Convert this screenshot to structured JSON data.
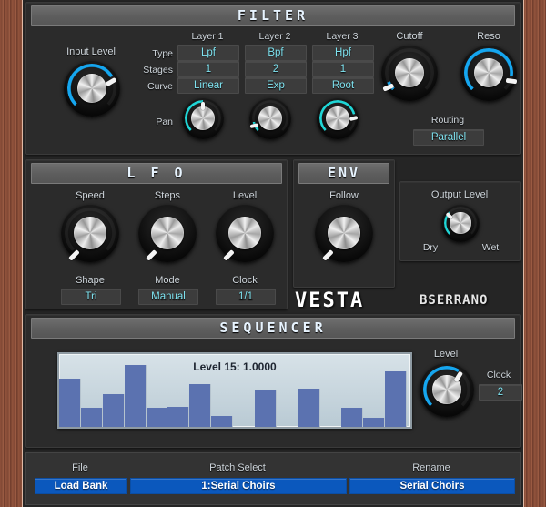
{
  "app": {
    "brand": "VESTA",
    "vendor": "BSERRANO"
  },
  "filter": {
    "title": "FILTER",
    "input_level_label": "Input Level",
    "input_level_value": 0.72,
    "row_labels": [
      "Type",
      "Stages",
      "Curve"
    ],
    "layer_headers": [
      "Layer 1",
      "Layer 2",
      "Layer 3"
    ],
    "type": [
      "Lpf",
      "Bpf",
      "Hpf"
    ],
    "stages": [
      "1",
      "2",
      "1"
    ],
    "curve": [
      "Linear",
      "Exp",
      "Root"
    ],
    "pan_label": "Pan",
    "pan_values": [
      0.5,
      0.12,
      0.78
    ],
    "cutoff_label": "Cutoff",
    "cutoff_value": 0.08,
    "reso_label": "Reso",
    "reso_value": 0.86,
    "routing_label": "Routing",
    "routing_value": "Parallel"
  },
  "lfo": {
    "title": "L F O",
    "knobs": [
      {
        "label": "Speed",
        "value": 0.0
      },
      {
        "label": "Steps",
        "value": 0.0
      },
      {
        "label": "Level",
        "value": 0.0
      }
    ],
    "shape_label": "Shape",
    "shape_value": "Tri",
    "mode_label": "Mode",
    "mode_value": "Manual",
    "clock_label": "Clock",
    "clock_value": "1/1"
  },
  "env": {
    "title": "ENV",
    "follow_label": "Follow",
    "follow_value": 0.0
  },
  "output": {
    "label": "Output Level",
    "value": 0.33,
    "dry_label": "Dry",
    "wet_label": "Wet"
  },
  "sequencer": {
    "title": "SEQUENCER",
    "caption": "Level 15: 1.0000",
    "level_label": "Level",
    "level_value": 0.62,
    "clock_label": "Clock",
    "clock_value": "2"
  },
  "bottom": {
    "file_label": "File",
    "load_bank_label": "Load Bank",
    "patch_select_label": "Patch Select",
    "patch_select_value": "1:Serial Choirs",
    "rename_label": "Rename",
    "rename_value": "Serial Choirs"
  },
  "colors": {
    "led_blue": "#15a6ef",
    "led_cyan": "#1fd6d6",
    "value_text": "#7fe3f0",
    "button_blue": "#0b58bd",
    "bar_blue": "#5b72b0"
  },
  "chart_data": {
    "type": "bar",
    "title": "Level 15: 1.0000",
    "categories": [
      "1",
      "2",
      "3",
      "4",
      "5",
      "6",
      "7",
      "8",
      "9",
      "10",
      "11",
      "12",
      "13",
      "14",
      "15",
      "16"
    ],
    "values": [
      0.7,
      0.28,
      0.48,
      0.9,
      0.28,
      0.29,
      0.62,
      0.16,
      0.0,
      0.52,
      0.0,
      0.55,
      0.0,
      0.27,
      0.13,
      0.8
    ],
    "ylim": [
      0,
      1
    ],
    "xlabel": "",
    "ylabel": "",
    "grid": false,
    "legend": false
  }
}
